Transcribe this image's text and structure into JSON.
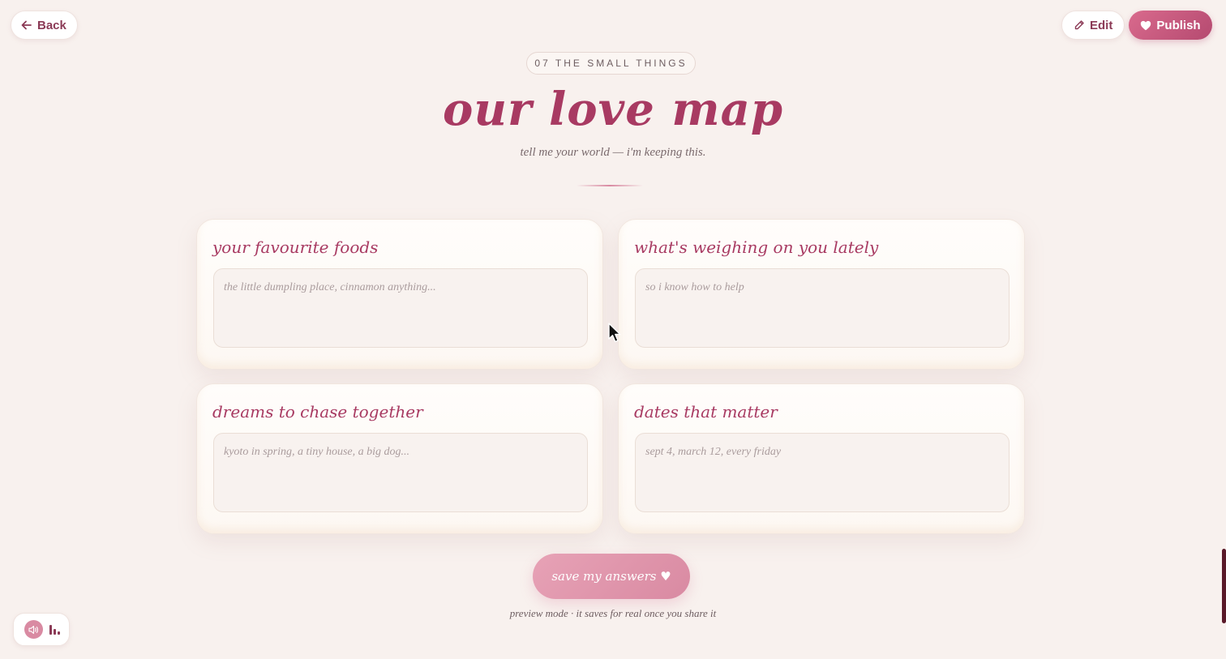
{
  "topbar": {
    "back_label": "Back",
    "edit_label": "Edit",
    "publish_label": "Publish"
  },
  "header": {
    "chip": "07 THE SMALL THINGS",
    "title": "our love map",
    "subtitle": "tell me your world — i'm keeping this."
  },
  "cards": [
    {
      "label": "your favourite foods",
      "placeholder": "the little dumpling place, cinnamon anything..."
    },
    {
      "label": "what's weighing on you lately",
      "placeholder": "so i know how to help"
    },
    {
      "label": "dreams to chase together",
      "placeholder": "kyoto in spring, a tiny house, a big dog..."
    },
    {
      "label": "dates that matter",
      "placeholder": "sept 4, march 12, every friday"
    }
  ],
  "save": {
    "label": "save my answers ♥",
    "note": "preview mode · it saves for real once you share it"
  },
  "icons": {
    "back": "arrow-left-icon",
    "edit": "pencil-icon",
    "publish": "heart-icon",
    "audio": "speaker-icon",
    "equalizer": "equalizer-bars-icon"
  },
  "colors": {
    "background": "#f8f1ee",
    "accent": "#a83a62",
    "publish_gradient_start": "#d96a8d",
    "publish_gradient_end": "#b54a70",
    "save_button": "#e7a2b6"
  }
}
